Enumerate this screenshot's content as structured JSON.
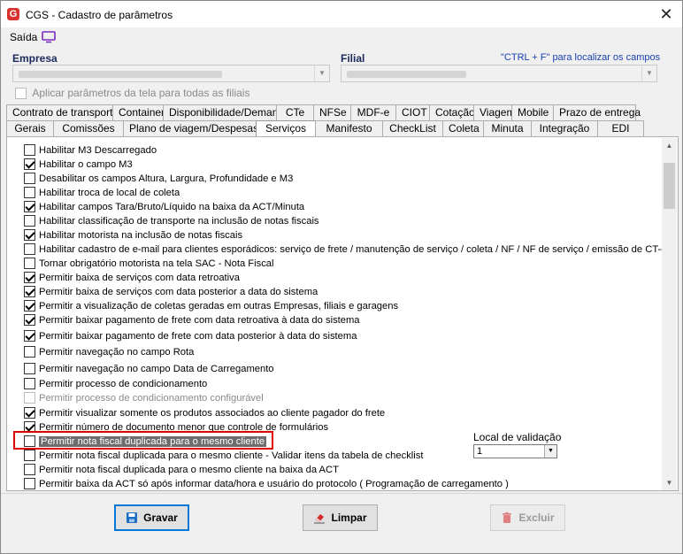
{
  "window": {
    "title": "CGS - Cadastro de parâmetros",
    "app_icon_letter": "G"
  },
  "menu": {
    "saida": "Saída"
  },
  "empresa": {
    "label": "Empresa"
  },
  "filial": {
    "label": "Filial"
  },
  "hint": "\"CTRL + F\" para localizar os campos",
  "apply_all": {
    "label": "Aplicar parâmetros da tela para todas as filiais",
    "checked": false,
    "enabled": false
  },
  "tabs_row1": [
    "Contrato de transporte",
    "Container",
    "Disponibilidade/Demanda",
    "CTe",
    "NFSe",
    "MDF-e",
    "CIOT",
    "Cotação",
    "Viagem",
    "Mobile",
    "Prazo de entrega"
  ],
  "tabs_row2": [
    "Gerais",
    "Comissões",
    "Plano de viagem/Despesas",
    "Serviços",
    "Manifesto",
    "CheckList",
    "Coleta",
    "Minuta",
    "Integração",
    "EDI"
  ],
  "active_tab": "Serviços",
  "options": [
    {
      "label": "Habilitar M3 Descarregado",
      "checked": false
    },
    {
      "label": "Habilitar o campo M3",
      "checked": true
    },
    {
      "label": "Desabilitar os campos Altura, Largura, Profundidade e M3",
      "checked": false
    },
    {
      "label": "Habilitar troca de local de coleta",
      "checked": false
    },
    {
      "label": "Habilitar campos Tara/Bruto/Líquido na baixa da ACT/Minuta",
      "checked": true
    },
    {
      "label": "Habilitar classificação de transporte na inclusão de notas fiscais",
      "checked": false
    },
    {
      "label": "Habilitar motorista na inclusão de notas fiscais",
      "checked": true
    },
    {
      "label": "Habilitar cadastro de e-mail para clientes esporádicos: serviço de frete / manutenção de serviço / coleta / NF / NF de serviço / emissão de CT-e",
      "checked": false
    },
    {
      "label": "Tornar obrigatório motorista na tela SAC - Nota Fiscal",
      "checked": false
    },
    {
      "label": "Permitir baixa de serviços com data retroativa",
      "checked": true
    },
    {
      "label": "Permitir baixa de serviços com data posterior a data do sistema",
      "checked": true
    },
    {
      "label": "Permitir a visualização de coletas geradas em outras Empresas, filiais e garagens",
      "checked": true
    },
    {
      "label": "Permitir baixar pagamento de frete com data retroativa à data do sistema",
      "checked": true
    },
    {
      "label": "Permitir baixar pagamento de frete com data posterior à data do sistema",
      "checked": true
    },
    {
      "label": "Permitir navegação no campo Rota",
      "checked": false
    },
    {
      "label": "Permitir navegação no campo Data de Carregamento",
      "checked": false
    },
    {
      "label": "Permitir processo de condicionamento",
      "checked": false
    },
    {
      "label": "Permitir processo de condicionamento configurável",
      "checked": false,
      "disabled": true
    },
    {
      "label": "Permitir visualizar somente os produtos associados ao cliente pagador do frete",
      "checked": true
    },
    {
      "label": "Permitir número de documento menor que controle de formulários",
      "checked": true
    },
    {
      "label": "Permitir nota fiscal duplicada para o mesmo cliente",
      "checked": false,
      "highlighted": true
    },
    {
      "label": "Permitir nota fiscal duplicada para o mesmo cliente - Validar itens da tabela de checklist",
      "checked": false
    },
    {
      "label": "Permitir nota fiscal duplicada para o mesmo cliente na baixa da ACT",
      "checked": false
    },
    {
      "label": "Permitir baixa da ACT só após informar data/hora e usuário do protocolo ( Programação de carregamento )",
      "checked": false
    }
  ],
  "local_validacao": {
    "label": "Local de validação",
    "value": "1"
  },
  "buttons": {
    "gravar": "Gravar",
    "limpar": "Limpar",
    "excluir": "Excluir"
  },
  "colors": {
    "accent": "#0078d7",
    "highlight_box": "#e00000",
    "hint": "#1a3fb0"
  }
}
